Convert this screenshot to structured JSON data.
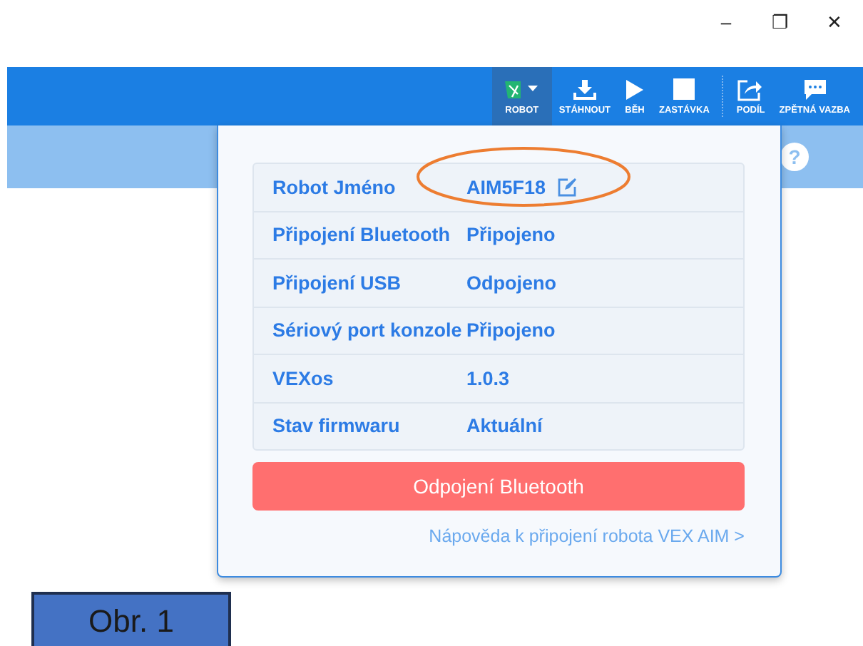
{
  "window_controls": [
    "–",
    "❐",
    "✕"
  ],
  "toolbar": [
    {
      "kind": "robot",
      "label": "ROBOT",
      "selected": true
    },
    {
      "kind": "download",
      "label": "STÁHNOUT",
      "selected": false
    },
    {
      "kind": "play",
      "label": "BĚH",
      "selected": false
    },
    {
      "kind": "stop",
      "label": "ZASTÁVKA",
      "selected": false
    },
    {
      "kind": "separator"
    },
    {
      "kind": "share",
      "label": "PODÍL",
      "selected": false
    },
    {
      "kind": "feedback",
      "label": "ZPĚTNÁ VAZBA",
      "selected": false
    }
  ],
  "help_button": "?",
  "robot_panel": {
    "rows": [
      {
        "label": "Robot Jméno",
        "value": "AIM5F18",
        "editable": true,
        "highlighted": true
      },
      {
        "label": "Připojení Bluetooth",
        "value": "Připojeno",
        "editable": false,
        "highlighted": false
      },
      {
        "label": "Připojení USB",
        "value": "Odpojeno",
        "editable": false,
        "highlighted": false
      },
      {
        "label": "Sériový port konzole",
        "value": "Připojeno",
        "editable": false,
        "highlighted": false
      },
      {
        "label": "VEXos",
        "value": "1.0.3",
        "editable": false,
        "highlighted": false
      },
      {
        "label": "Stav firmwaru",
        "value": "Aktuální",
        "editable": false,
        "highlighted": false
      }
    ],
    "disconnect_button": "Odpojení Bluetooth",
    "help_link": "Nápověda k připojení robota VEX AIM >"
  },
  "figure_label": "Obr. 1"
}
